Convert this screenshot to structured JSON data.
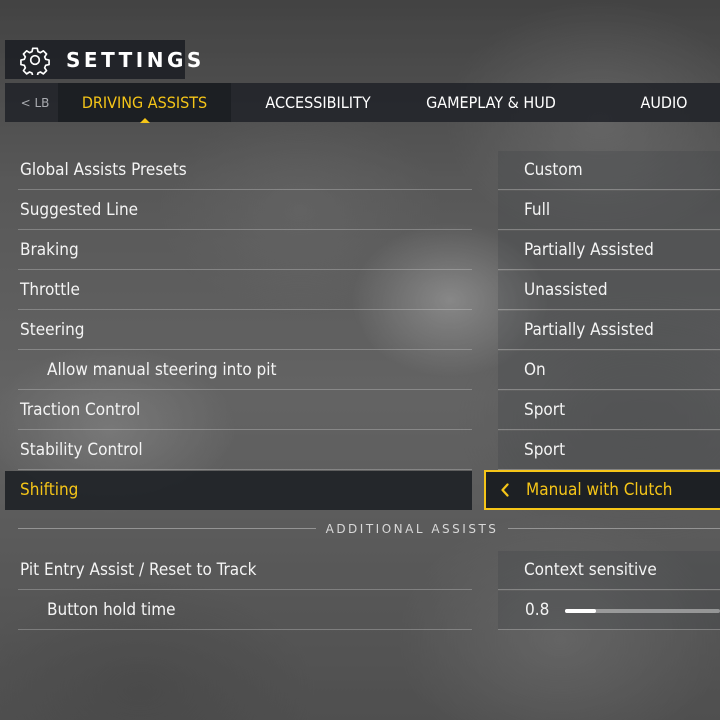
{
  "header": {
    "title": "SETTINGS",
    "icon": "gear-icon"
  },
  "tabs": {
    "prev_hint": "< LB",
    "items": [
      "DRIVING ASSISTS",
      "ACCESSIBILITY",
      "GAMEPLAY & HUD",
      "AUDIO"
    ],
    "active": "DRIVING ASSISTS"
  },
  "settings": [
    {
      "label": "Global Assists Presets",
      "value": "Custom"
    },
    {
      "label": "Suggested Line",
      "value": "Full"
    },
    {
      "label": "Braking",
      "value": "Partially Assisted"
    },
    {
      "label": "Throttle",
      "value": "Unassisted"
    },
    {
      "label": "Steering",
      "value": "Partially Assisted"
    },
    {
      "label": "Allow manual steering into pit",
      "value": "On"
    },
    {
      "label": "Traction Control",
      "value": "Sport"
    },
    {
      "label": "Stability Control",
      "value": "Sport"
    },
    {
      "label": "Shifting",
      "value": "Manual with Clutch"
    }
  ],
  "selected_setting": "Shifting",
  "additional": {
    "title": "ADDITIONAL ASSISTS",
    "rows": [
      {
        "label": "Pit Entry Assist / Reset to Track",
        "value": "Context sensitive"
      },
      {
        "label": "Button hold time",
        "value": "0.8",
        "slider_fraction": 0.2
      }
    ]
  },
  "colors": {
    "accent": "#f5c518",
    "panel": "#1e2126"
  }
}
